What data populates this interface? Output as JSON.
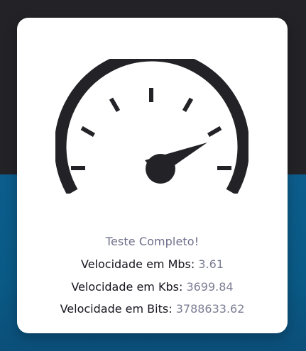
{
  "status": {
    "text": "Teste Completo!"
  },
  "results": [
    {
      "label": "Velocidade em Mbs:",
      "value": "3.61"
    },
    {
      "label": "Velocidade em Kbs:",
      "value": "3699.84"
    },
    {
      "label": "Velocidade em Bits:",
      "value": "3788633.62"
    }
  ],
  "gauge": {
    "icon": "speedometer-icon"
  },
  "colors": {
    "background_dark": "#232327",
    "background_blue": "#0c5d8c",
    "card": "#ffffff",
    "gauge": "#232327",
    "label_text": "#15151f",
    "muted_text": "#6d6f8a"
  }
}
